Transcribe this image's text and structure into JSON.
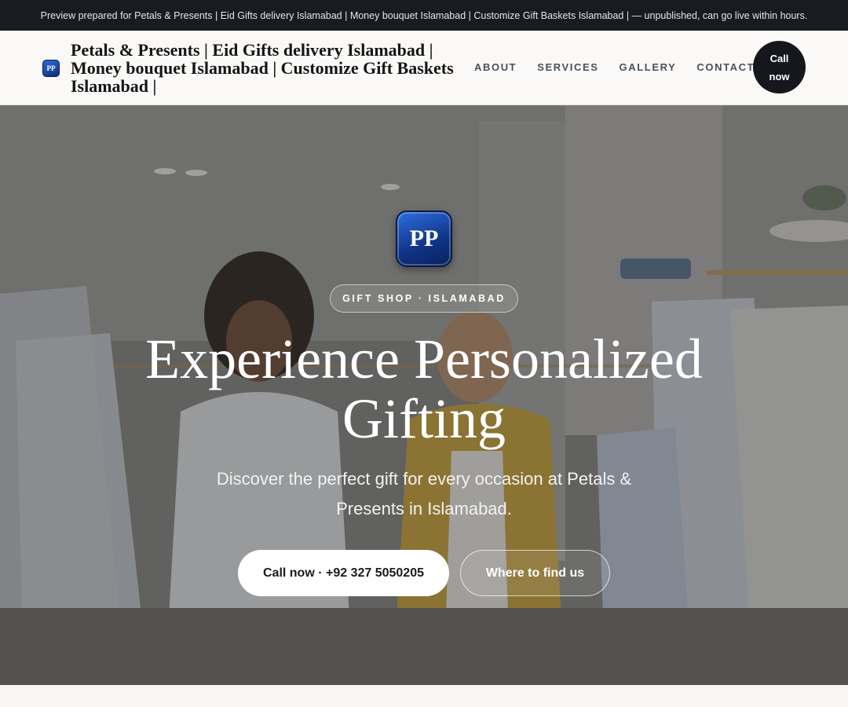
{
  "preview_banner": "Preview prepared for Petals & Presents | Eid Gifts delivery Islamabad | Money bouquet Islamabad | Customize Gift Baskets Islamabad | — unpublished, can go live within hours.",
  "header": {
    "logo_initials": "PP",
    "brand_title": "Petals & Presents | Eid Gifts delivery Islamabad | Money bouquet Islamabad | Customize Gift Baskets Islamabad |",
    "nav": [
      "ABOUT",
      "SERVICES",
      "GALLERY",
      "CONTACT"
    ],
    "call_label": "Call now"
  },
  "hero": {
    "logo_initials": "PP",
    "badge": "GIFT SHOP · ISLAMABAD",
    "title": "Experience Personalized Gifting",
    "subtitle": "Discover the perfect gift for every occasion at Petals & Presents in Islamabad.",
    "primary_cta": "Call now · +92 327 5050205",
    "secondary_cta": "Where to find us"
  },
  "colors": {
    "topbar_bg": "#181b22",
    "logo_blue": "#103385",
    "call_pill_bg": "#15171c"
  }
}
